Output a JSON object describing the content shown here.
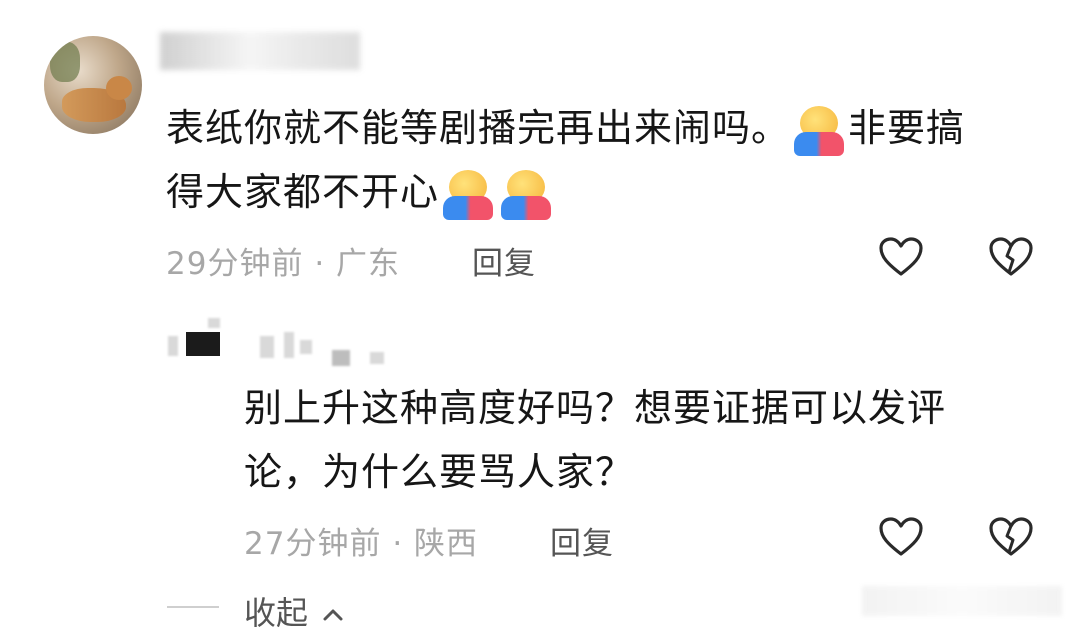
{
  "comments": [
    {
      "text_line1": "表纸你就不能等剧播完再出来闹吗。",
      "text_line1b": "非要搞",
      "text_line2": "得大家都不开心",
      "time": "29分钟前",
      "dot": "·",
      "location": "广东",
      "reply_label": "回复"
    },
    {
      "text_line1": "别上升这种高度好吗？想要证据可以发评",
      "text_line2": "论，为什么要骂人家？",
      "time": "27分钟前",
      "dot": "·",
      "location": "陕西",
      "reply_label": "回复"
    }
  ],
  "collapse_label": "收起",
  "icons": {
    "like": "heart-outline-icon",
    "dislike": "broken-heart-icon",
    "emoji": "hugging-face-emoji",
    "collapse": "chevron-up-icon"
  },
  "colors": {
    "text": "#161616",
    "meta": "#a7a7a7",
    "icon": "#2a2a2a"
  }
}
